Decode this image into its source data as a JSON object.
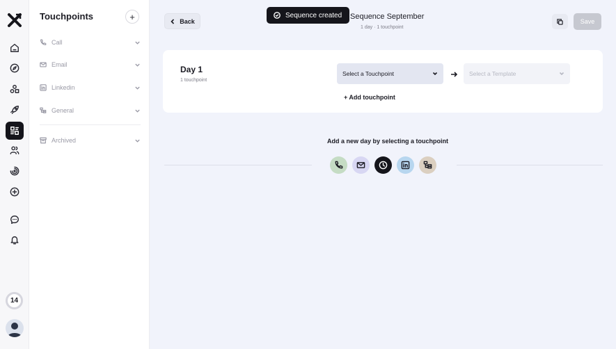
{
  "panel": {
    "title": "Touchpoints",
    "add_label": "+",
    "groups": [
      {
        "label": "Call",
        "icon": "phone-icon"
      },
      {
        "label": "Email",
        "icon": "mail-icon"
      },
      {
        "label": "Linkedin",
        "icon": "linkedin-icon"
      },
      {
        "label": "General",
        "icon": "general-icon"
      },
      {
        "label": "Archived",
        "icon": "archive-icon"
      }
    ]
  },
  "rail": {
    "notification_count": "14",
    "icons": [
      "home-icon",
      "compass-icon",
      "shapes-icon",
      "rocket-icon",
      "sequences-icon",
      "users-icon",
      "signal-icon",
      "plus-circle-icon",
      "chat-icon",
      "bell-icon"
    ]
  },
  "header": {
    "back_label": "Back",
    "toast": "Sequence created",
    "title": "Sequence September",
    "meta": "1 day · 1 touchpoint",
    "save_label": "Save"
  },
  "day": {
    "title": "Day 1",
    "subtitle": "1 touchpoint",
    "touchpoint_select": "Select a Touchpoint",
    "template_select": "Select a Template",
    "add_touchpoint": "+ Add touchpoint"
  },
  "add_day": {
    "label": "Add a new day by selecting a touchpoint",
    "touchpoints": [
      {
        "type": "call",
        "icon": "phone-icon",
        "color": "#c5dcc4"
      },
      {
        "type": "email",
        "icon": "mail-icon",
        "color": "#d8d7f3"
      },
      {
        "type": "delay",
        "icon": "clock-icon",
        "color": "#15151b"
      },
      {
        "type": "linkedin",
        "icon": "linkedin-icon",
        "color": "#b7d6ef"
      },
      {
        "type": "general",
        "icon": "general-icon",
        "color": "#dbcfc0"
      }
    ]
  }
}
